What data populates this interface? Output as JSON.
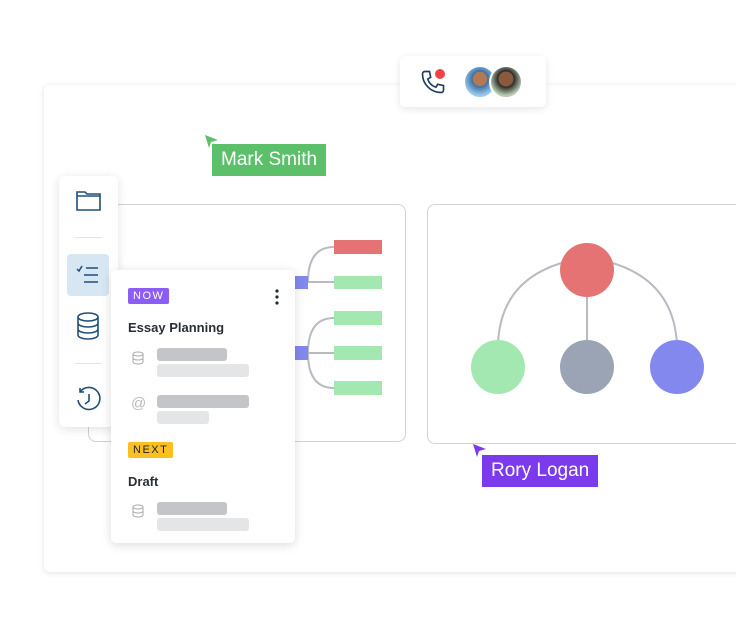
{
  "call": {
    "icon": "phone-icon",
    "recording_color": "#ef4444",
    "participants": [
      "avatar-man",
      "avatar-woman"
    ]
  },
  "cursors": [
    {
      "name": "Mark Smith",
      "color": "#5cbf6a"
    },
    {
      "name": "Rory Logan",
      "color": "#7c3aed"
    }
  ],
  "sidebar": {
    "items": [
      "folder-icon",
      "checklist-icon",
      "database-icon",
      "history-icon"
    ],
    "active": "checklist-icon"
  },
  "task_card": {
    "sections": [
      {
        "badge": "NOW",
        "badge_color": "#8b5cf6",
        "title": "Essay Planning",
        "rows": [
          "database-icon",
          "at-icon"
        ]
      },
      {
        "badge": "NEXT",
        "badge_color": "#fbbf24",
        "title": "Draft",
        "rows": [
          "database-icon"
        ]
      }
    ],
    "menu_icon": "more-vertical-icon"
  },
  "colors": {
    "red": "#e57373",
    "green": "#a3e8b0",
    "blue": "#8388ef",
    "gray": "#9aa4b4"
  }
}
